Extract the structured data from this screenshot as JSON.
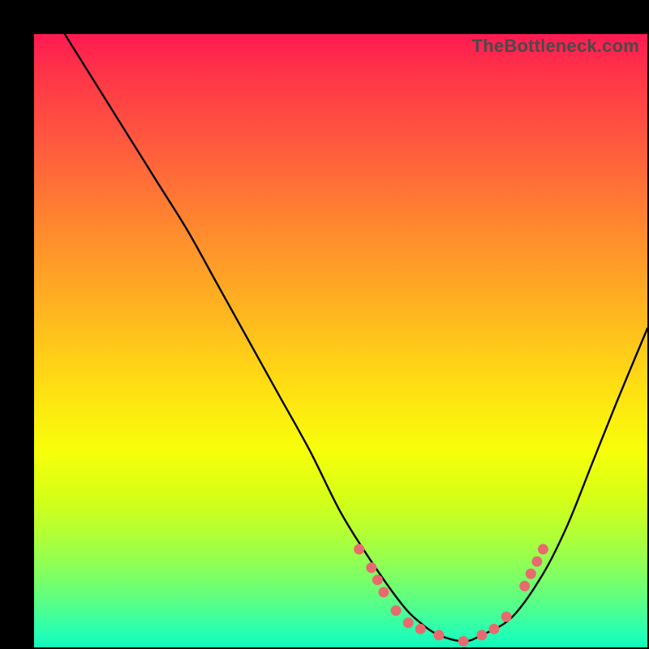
{
  "watermark": "TheBottleneck.com",
  "chart_data": {
    "type": "line",
    "title": "",
    "xlabel": "",
    "ylabel": "",
    "xlim": [
      0,
      100
    ],
    "ylim": [
      0,
      100
    ],
    "grid": false,
    "legend": false,
    "series": [
      {
        "name": "curve",
        "x": [
          5,
          10,
          15,
          20,
          25,
          30,
          35,
          40,
          45,
          50,
          55,
          60,
          63,
          66,
          70,
          73,
          78,
          83,
          87,
          91,
          95,
          100
        ],
        "y": [
          100,
          92,
          84,
          76,
          68,
          59,
          50,
          41,
          32,
          22,
          14,
          7,
          4,
          2,
          1,
          2,
          5,
          12,
          20,
          30,
          40,
          52
        ]
      },
      {
        "name": "points",
        "type": "scatter",
        "color": "#e86a6f",
        "x": [
          53,
          55,
          56,
          57,
          59,
          61,
          63,
          66,
          70,
          73,
          75,
          77,
          80,
          81,
          82,
          83
        ],
        "y": [
          16,
          13,
          11,
          9,
          6,
          4,
          3,
          2,
          1,
          2,
          3,
          5,
          10,
          12,
          14,
          16
        ]
      }
    ]
  }
}
